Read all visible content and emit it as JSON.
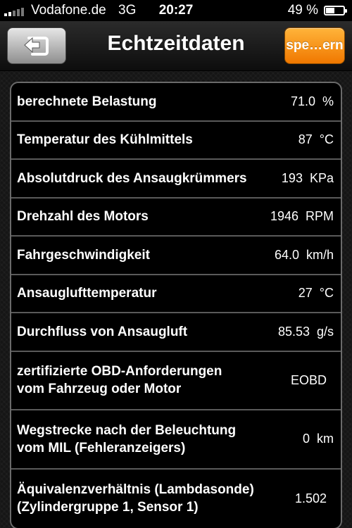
{
  "status_bar": {
    "carrier": "Vodafone.de",
    "network": "3G",
    "time": "20:27",
    "battery_percent": "49 %",
    "battery_level": 0.49,
    "signal_strength": "2 of 5 bars"
  },
  "nav": {
    "title": "Echtzeitdaten",
    "back_icon": "back-arrow-icon",
    "save_label": "spe…ern",
    "save_color": "#f28a00"
  },
  "rows": [
    {
      "label": "berechnete Belastung",
      "value": "71.0",
      "unit": "%"
    },
    {
      "label": "Temperatur des Kühlmittels",
      "value": "87",
      "unit": "°C"
    },
    {
      "label": "Absolutdruck des Ansaugkrümmers",
      "value": "193",
      "unit": "KPa"
    },
    {
      "label": "Drehzahl des Motors",
      "value": "1946",
      "unit": "RPM"
    },
    {
      "label": "Fahrgeschwindigkeit",
      "value": "64.0",
      "unit": "km/h"
    },
    {
      "label": "Ansauglufttemperatur",
      "value": "27",
      "unit": "°C"
    },
    {
      "label": "Durchfluss von Ansaugluft",
      "value": "85.53",
      "unit": "g/s"
    },
    {
      "label_line1": "zertifizierte OBD-Anforderungen",
      "label_line2": "vom Fahrzeug oder Motor",
      "value": "EOBD",
      "unit": ""
    },
    {
      "label_line1": "Wegstrecke nach der Beleuchtung",
      "label_line2": "vom MIL (Fehleranzeigers)",
      "value": "0",
      "unit": "km"
    },
    {
      "label_line1": "Äquivalenzverhältnis (Lambdasonde)",
      "label_line2": "(Zylindergruppe 1, Sensor 1)",
      "value": "1.502",
      "unit": ""
    }
  ]
}
